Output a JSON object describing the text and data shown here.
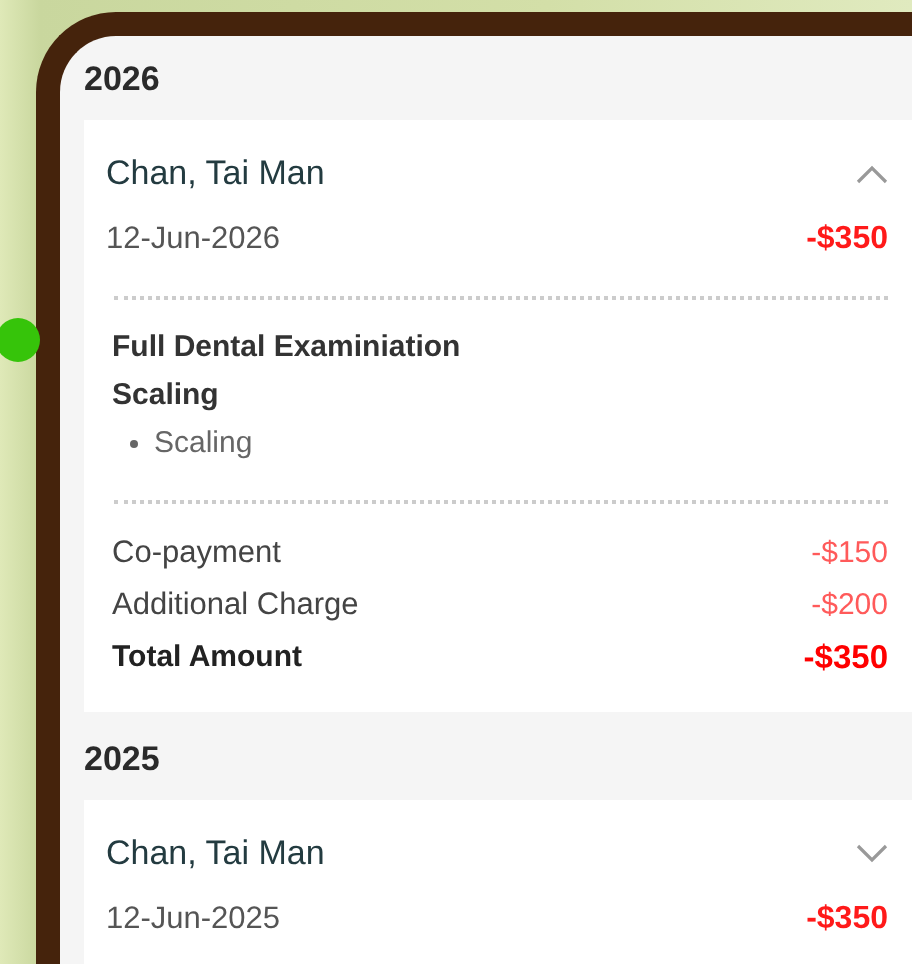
{
  "sections": [
    {
      "year": "2026",
      "records": [
        {
          "name": "Chan, Tai Man",
          "expanded": true,
          "date": "12-Jun-2026",
          "amount": "-$350",
          "services": [
            {
              "title": "Full Dental Examiniation"
            },
            {
              "title": "Scaling",
              "items": [
                "Scaling"
              ]
            }
          ],
          "charges": [
            {
              "kind": "line",
              "label": "Co-payment",
              "amount": "-$150"
            },
            {
              "kind": "line",
              "label": "Additional Charge",
              "amount": "-$200"
            },
            {
              "kind": "total",
              "label": "Total Amount",
              "amount": "-$350"
            }
          ]
        }
      ]
    },
    {
      "year": "2025",
      "records": [
        {
          "name": "Chan, Tai Man",
          "expanded": false,
          "date": "12-Jun-2025",
          "amount": "-$350"
        }
      ]
    }
  ]
}
